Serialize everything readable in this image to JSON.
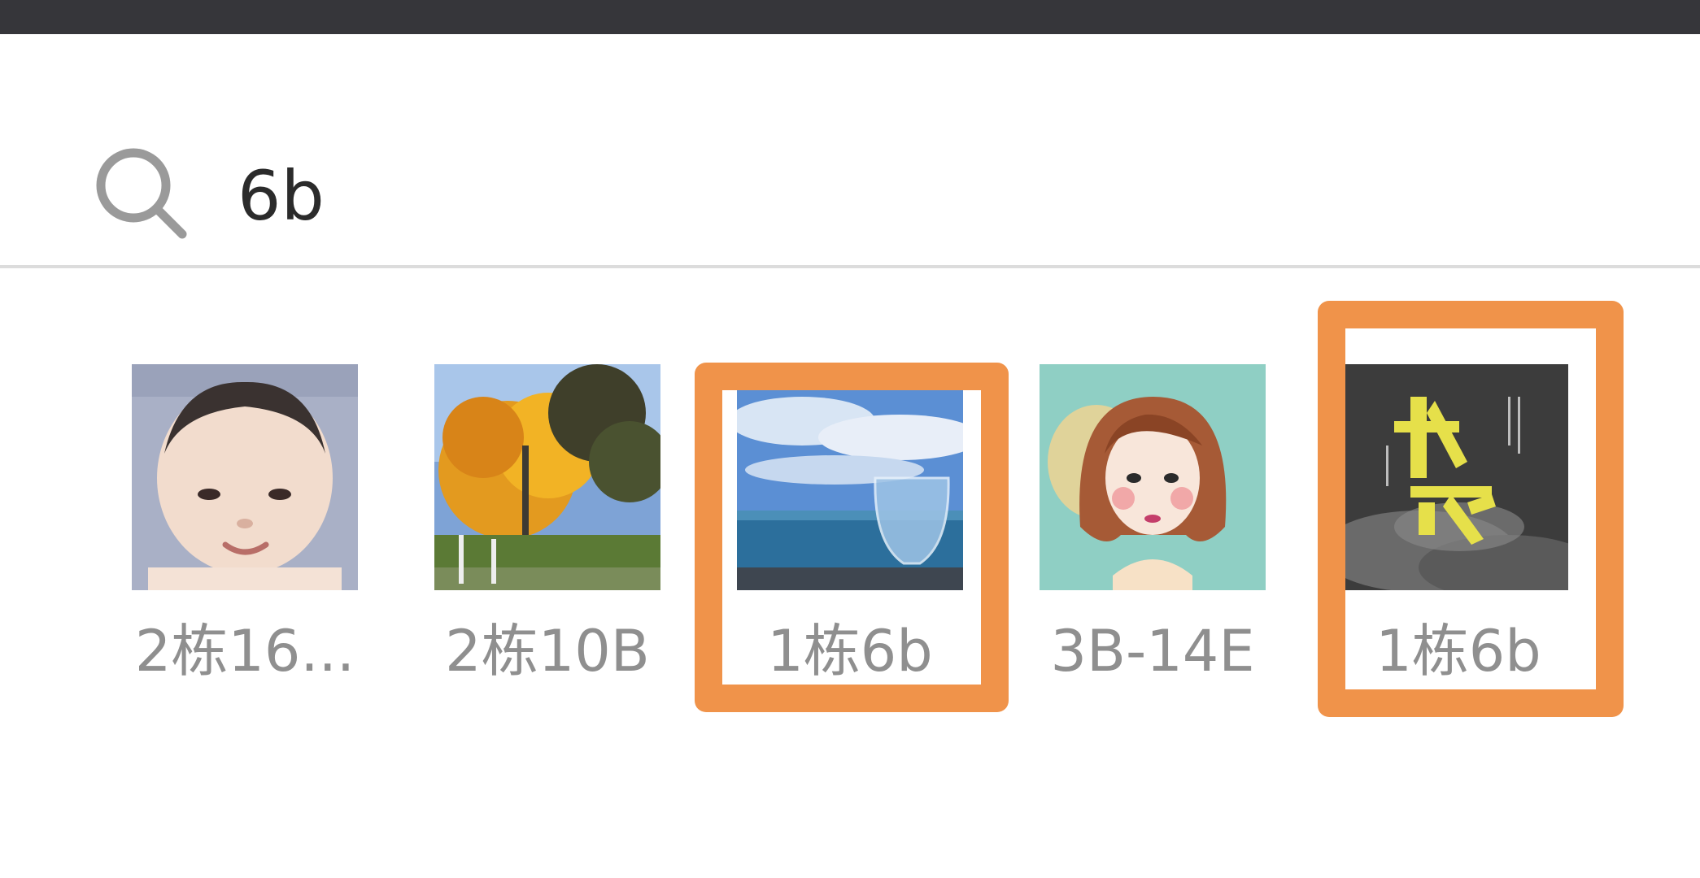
{
  "search": {
    "icon": "search-icon",
    "query": "6b"
  },
  "results": [
    {
      "name": "2栋16...",
      "avatar": "baby-photo"
    },
    {
      "name": "2栋10B",
      "avatar": "autumn-tree-photo"
    },
    {
      "name": "1栋6b",
      "avatar": "sea-glass-photo",
      "highlighted": true
    },
    {
      "name": "3B-14E",
      "avatar": "cartoon-girl-drawing"
    },
    {
      "name": "1栋6b",
      "avatar": "calligraphy-poster",
      "highlighted": true
    }
  ],
  "colors": {
    "status_bar": "#36363a",
    "highlight": "#f0934a",
    "name_text": "#8f8f8f",
    "query_text": "#2b2b2b"
  }
}
